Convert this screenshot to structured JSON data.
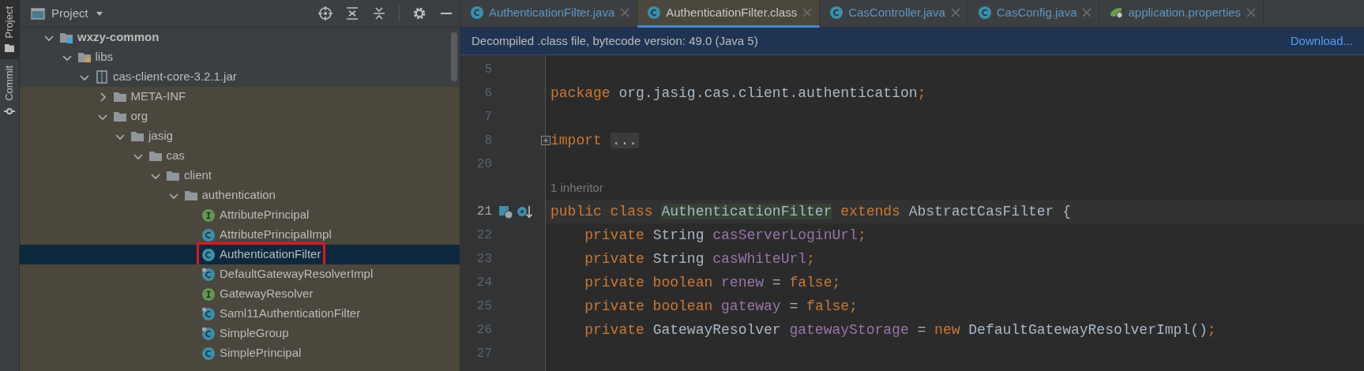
{
  "sidebar_tabs": [
    {
      "label": "Project",
      "kind": "project",
      "selected": true
    },
    {
      "label": "Commit",
      "kind": "commit",
      "selected": false
    }
  ],
  "project_panel": {
    "title": "Project",
    "tree": [
      {
        "label": "wxzy-common",
        "kind": "module",
        "expanded": true,
        "selected": false,
        "children": [
          {
            "label": "libs",
            "kind": "library",
            "expanded": true,
            "selected": false,
            "children": [
              {
                "label": "cas-client-core-3.2.1.jar",
                "kind": "jar",
                "expanded": true,
                "selected": false,
                "children": [
                  {
                    "label": "META-INF",
                    "kind": "folder",
                    "expanded": false,
                    "selected": false
                  },
                  {
                    "label": "org",
                    "kind": "folder",
                    "expanded": true,
                    "selected": false,
                    "children": [
                      {
                        "label": "jasig",
                        "kind": "folder",
                        "expanded": true,
                        "selected": false,
                        "children": [
                          {
                            "label": "cas",
                            "kind": "folder",
                            "expanded": true,
                            "selected": false,
                            "children": [
                              {
                                "label": "client",
                                "kind": "folder",
                                "expanded": true,
                                "selected": false,
                                "children": [
                                  {
                                    "label": "authentication",
                                    "kind": "folder",
                                    "expanded": true,
                                    "selected": false,
                                    "children": [
                                      {
                                        "label": "AttributePrincipal",
                                        "kind": "interface",
                                        "selected": false
                                      },
                                      {
                                        "label": "AttributePrincipalImpl",
                                        "kind": "class",
                                        "final": false,
                                        "selected": false
                                      },
                                      {
                                        "label": "AuthenticationFilter",
                                        "kind": "class",
                                        "final": false,
                                        "selected": true,
                                        "annotated": true
                                      },
                                      {
                                        "label": "DefaultGatewayResolverImpl",
                                        "kind": "class",
                                        "final": true,
                                        "selected": false
                                      },
                                      {
                                        "label": "GatewayResolver",
                                        "kind": "interface",
                                        "selected": false
                                      },
                                      {
                                        "label": "Saml11AuthenticationFilter",
                                        "kind": "class",
                                        "final": true,
                                        "selected": false
                                      },
                                      {
                                        "label": "SimpleGroup",
                                        "kind": "class",
                                        "final": true,
                                        "selected": false
                                      },
                                      {
                                        "label": "SimplePrincipal",
                                        "kind": "class",
                                        "final": false,
                                        "selected": false
                                      }
                                    ]
                                  }
                                ]
                              }
                            ]
                          }
                        ]
                      }
                    ]
                  }
                ]
              }
            ]
          }
        ]
      }
    ]
  },
  "editor_tabs": [
    {
      "label": "AuthenticationFilter.java",
      "kind": "class",
      "selected": false
    },
    {
      "label": "AuthenticationFilter.class",
      "kind": "class",
      "selected": true
    },
    {
      "label": "CasController.java",
      "kind": "class",
      "selected": false
    },
    {
      "label": "CasConfig.java",
      "kind": "class",
      "selected": false
    },
    {
      "label": "application.properties",
      "kind": "spring",
      "selected": false
    }
  ],
  "notice": {
    "text": "Decompiled .class file, bytecode version: 49.0 (Java 5)",
    "link": "Download..."
  },
  "code_lines": [
    {
      "kind": "code",
      "number": "5",
      "current": false
    },
    {
      "kind": "code",
      "number": "6",
      "current": false,
      "tokens": [
        {
          "kind": "keyword",
          "text": "package"
        },
        {
          "kind": "plain",
          "text": " org.jasig.cas.client.authentication"
        },
        {
          "kind": "keyword",
          "text": ";"
        }
      ]
    },
    {
      "kind": "code",
      "number": "7",
      "current": false
    },
    {
      "kind": "code",
      "number": "8",
      "current": false,
      "folded": true,
      "tokens": [
        {
          "kind": "keyword",
          "text": "import "
        },
        {
          "kind": "folded",
          "text": "..."
        }
      ]
    },
    {
      "kind": "code",
      "number": "20",
      "current": false
    },
    {
      "kind": "hint",
      "text": "1 inheritor"
    },
    {
      "kind": "code",
      "number": "21",
      "current": true,
      "gutter_marks": true,
      "tokens": [
        {
          "kind": "keyword",
          "text": "public class "
        },
        {
          "kind": "usage",
          "text": "AuthenticationFilter"
        },
        {
          "kind": "keyword",
          "text": " extends "
        },
        {
          "kind": "plain",
          "text": "AbstractCasFilter {"
        }
      ]
    },
    {
      "kind": "code",
      "number": "22",
      "current": false,
      "tokens": [
        {
          "kind": "keyword",
          "text": "    private "
        },
        {
          "kind": "plain",
          "text": "String "
        },
        {
          "kind": "field",
          "text": "casServerLoginUrl"
        },
        {
          "kind": "keyword",
          "text": ";"
        }
      ]
    },
    {
      "kind": "code",
      "number": "23",
      "current": false,
      "tokens": [
        {
          "kind": "keyword",
          "text": "    private "
        },
        {
          "kind": "plain",
          "text": "String "
        },
        {
          "kind": "field",
          "text": "casWhiteUrl"
        },
        {
          "kind": "keyword",
          "text": ";"
        }
      ]
    },
    {
      "kind": "code",
      "number": "24",
      "current": false,
      "tokens": [
        {
          "kind": "keyword",
          "text": "    private boolean "
        },
        {
          "kind": "field",
          "text": "renew"
        },
        {
          "kind": "plain",
          "text": " = "
        },
        {
          "kind": "keyword",
          "text": "false;"
        }
      ]
    },
    {
      "kind": "code",
      "number": "25",
      "current": false,
      "tokens": [
        {
          "kind": "keyword",
          "text": "    private boolean "
        },
        {
          "kind": "field",
          "text": "gateway"
        },
        {
          "kind": "plain",
          "text": " = "
        },
        {
          "kind": "keyword",
          "text": "false;"
        }
      ]
    },
    {
      "kind": "code",
      "number": "26",
      "current": false,
      "tokens": [
        {
          "kind": "keyword",
          "text": "    private "
        },
        {
          "kind": "plain",
          "text": "GatewayResolver "
        },
        {
          "kind": "field",
          "text": "gatewayStorage"
        },
        {
          "kind": "plain",
          "text": " = "
        },
        {
          "kind": "keyword",
          "text": "new "
        },
        {
          "kind": "plain",
          "text": "DefaultGatewayResolverImpl()"
        },
        {
          "kind": "keyword",
          "text": ";"
        }
      ]
    },
    {
      "kind": "code",
      "number": "27",
      "current": false
    }
  ]
}
